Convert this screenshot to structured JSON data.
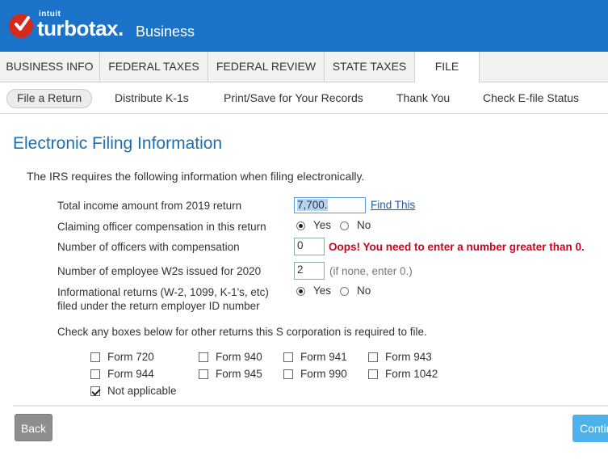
{
  "header": {
    "brand_small": "intuit",
    "brand_name": "turbotax.",
    "product": "Business"
  },
  "tabs": [
    {
      "label": "BUSINESS INFO"
    },
    {
      "label": "FEDERAL TAXES"
    },
    {
      "label": "FEDERAL REVIEW"
    },
    {
      "label": "STATE TAXES"
    },
    {
      "label": "FILE",
      "active": true
    }
  ],
  "subnav": [
    {
      "label": "File a Return",
      "active": true
    },
    {
      "label": "Distribute K-1s"
    },
    {
      "label": "Print/Save for Your Records"
    },
    {
      "label": "Thank You"
    },
    {
      "label": "Check E-file Status"
    }
  ],
  "page": {
    "title": "Electronic Filing Information",
    "intro": "The IRS requires the following information when filing electronically."
  },
  "form": {
    "total_income": {
      "label": "Total income amount from 2019 return",
      "value": "7,700.",
      "link": "Find This"
    },
    "officer_comp": {
      "label": "Claiming officer compensation in this return",
      "yes": "Yes",
      "no": "No",
      "selected": "Yes"
    },
    "num_officers": {
      "label": "Number of officers with compensation",
      "value": "0",
      "error": "Oops! You need to enter a number greater than 0."
    },
    "num_w2": {
      "label": "Number of employee W2s issued for 2020",
      "value": "2",
      "hint": "(if none, enter 0.)"
    },
    "info_returns": {
      "label_line1": "Informational returns (W-2, 1099, K-1's, etc)",
      "label_line2": "filed under the return employer ID number",
      "yes": "Yes",
      "no": "No",
      "selected": "Yes"
    },
    "check_instruction": "Check any boxes below for other returns this S corporation is required to file.",
    "checkboxes": [
      {
        "label": "Form 720",
        "checked": false
      },
      {
        "label": "Form 940",
        "checked": false
      },
      {
        "label": "Form 941",
        "checked": false
      },
      {
        "label": "Form 943",
        "checked": false
      },
      {
        "label": "Form 944",
        "checked": false
      },
      {
        "label": "Form 945",
        "checked": false
      },
      {
        "label": "Form 990",
        "checked": false
      },
      {
        "label": "Form 1042",
        "checked": false
      },
      {
        "label": "Not applicable",
        "checked": true
      }
    ]
  },
  "footer": {
    "back_label": "Back",
    "continue_label": "Continue"
  },
  "colors": {
    "header_blue": "#1a73c9",
    "title_blue": "#1a6fb5",
    "error_red": "#d0021b",
    "continue_blue": "#4db2ec",
    "back_gray": "#8e8e8e"
  },
  "icons": {
    "logo": "checkmark-circle-icon"
  }
}
